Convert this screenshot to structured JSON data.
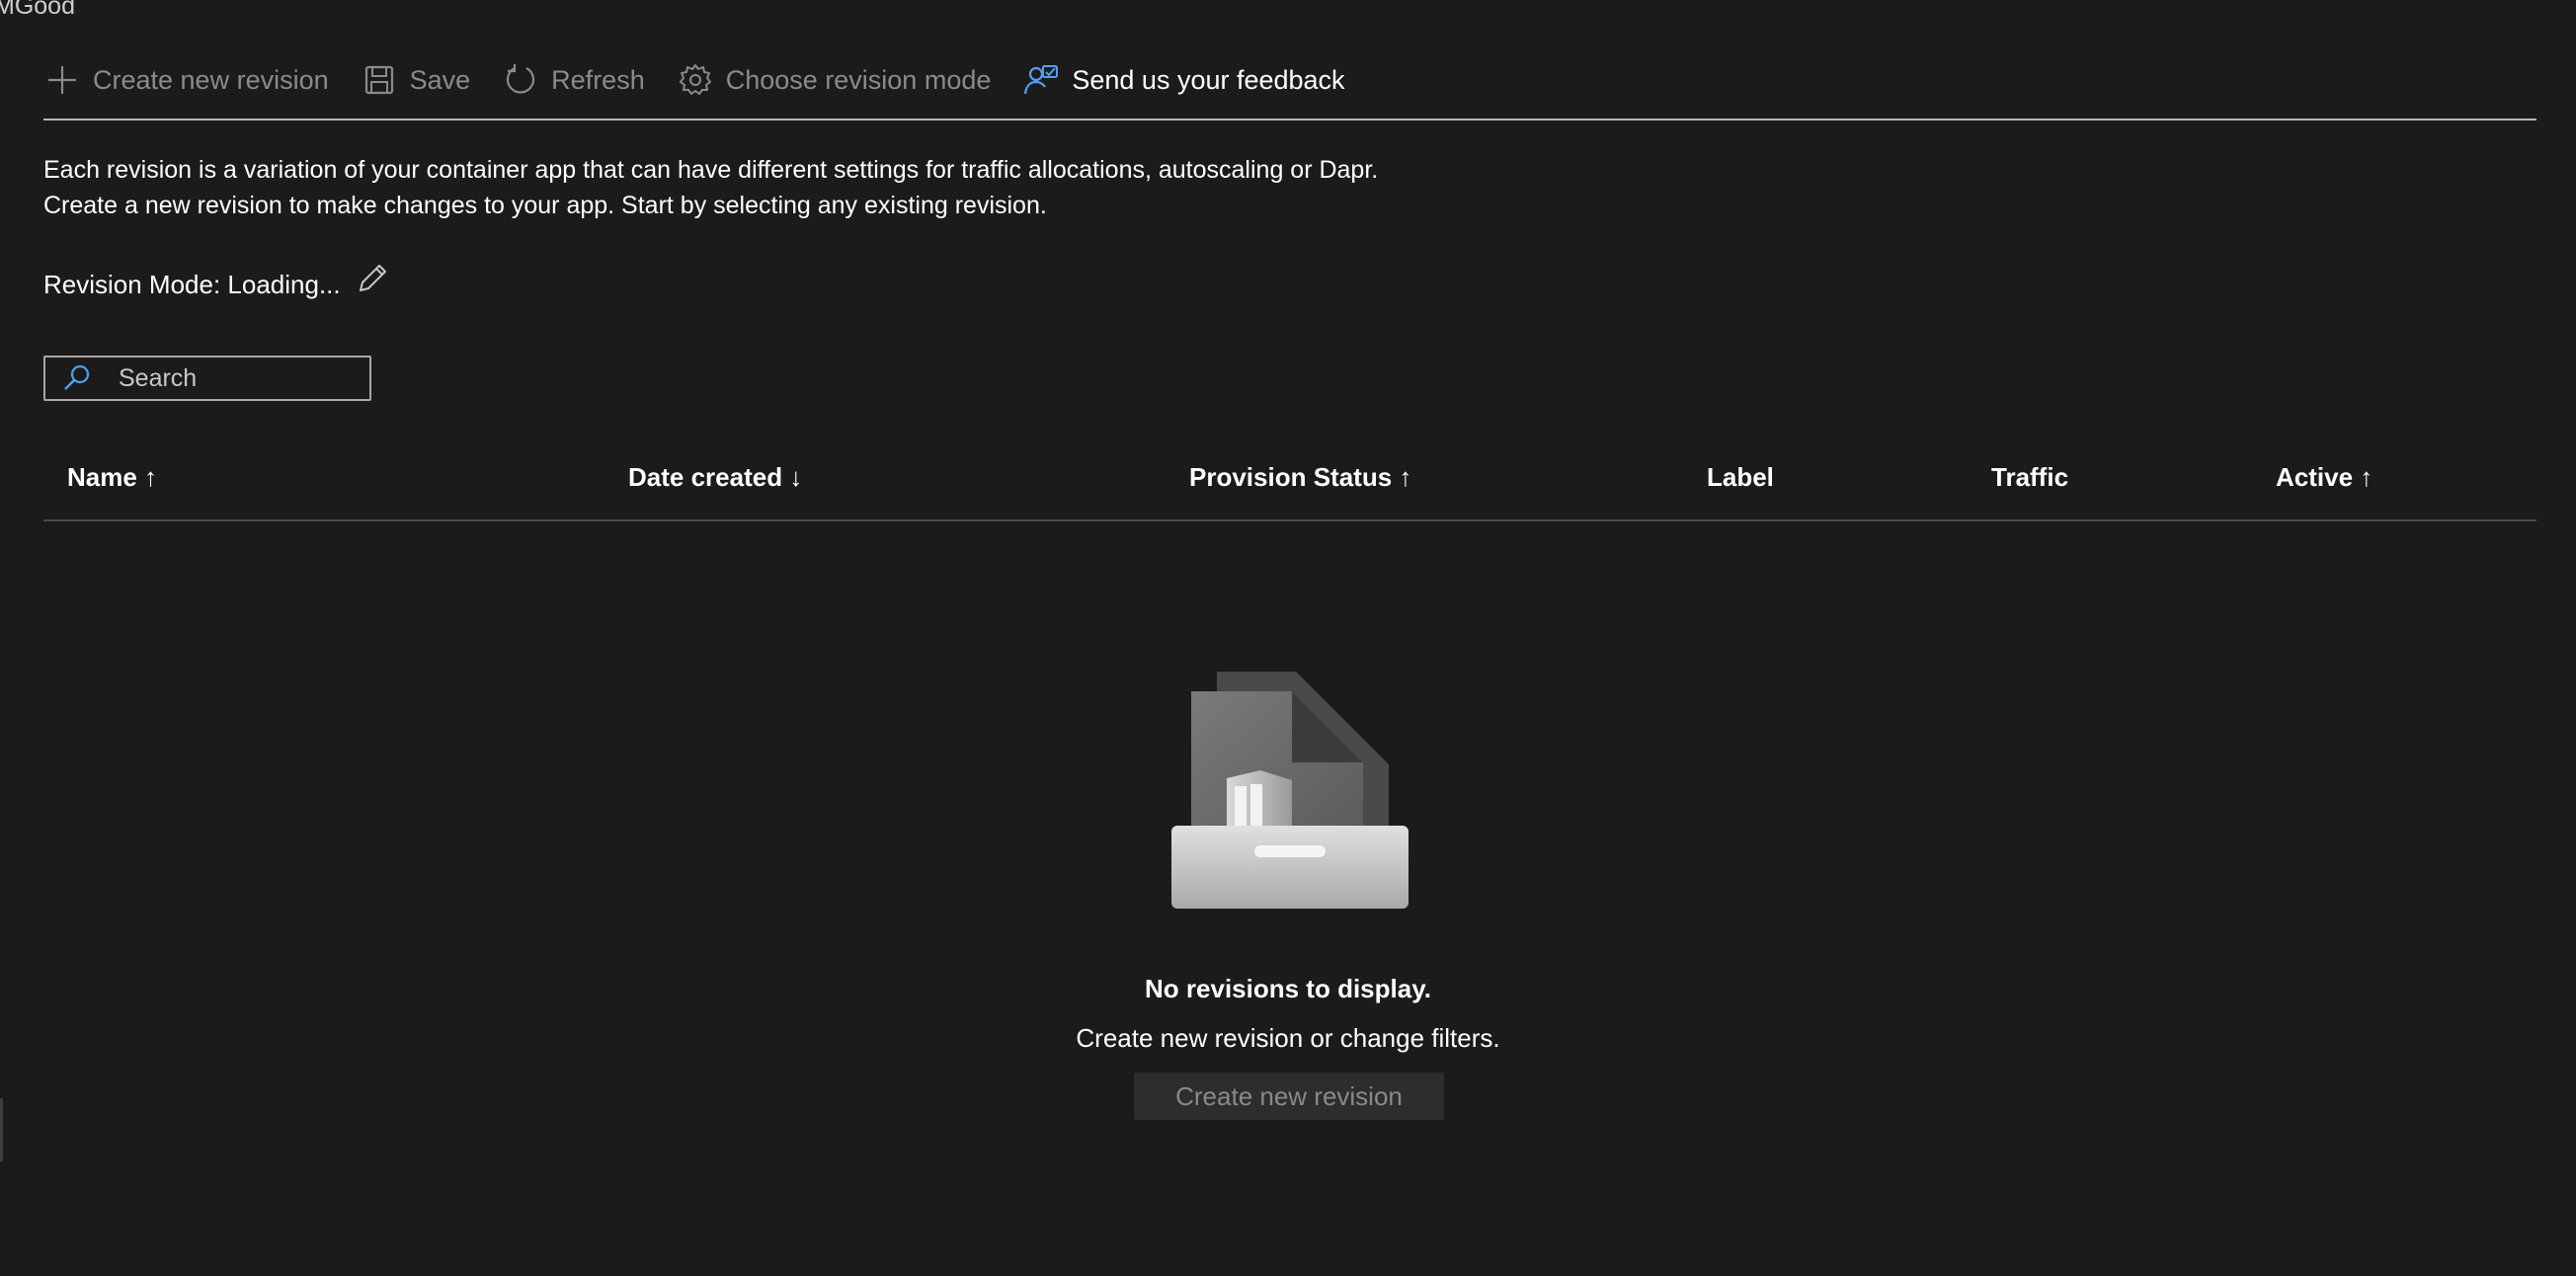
{
  "corner_text": "MGood",
  "toolbar": {
    "create_label": "Create new revision",
    "save_label": "Save",
    "refresh_label": "Refresh",
    "choose_mode_label": "Choose revision mode",
    "feedback_label": "Send us your feedback"
  },
  "description": {
    "line1": "Each revision is a variation of your container app that can have different settings for traffic allocations, autoscaling or Dapr.",
    "line2": "Create a new revision to make changes to your app. Start by selecting any existing revision."
  },
  "revision_mode": {
    "label": "Revision Mode: Loading..."
  },
  "search": {
    "placeholder": "Search",
    "value": ""
  },
  "table": {
    "columns": [
      {
        "label": "Name ↑"
      },
      {
        "label": "Date created ↓"
      },
      {
        "label": "Provision Status ↑"
      },
      {
        "label": "Label"
      },
      {
        "label": "Traffic"
      },
      {
        "label": "Active ↑"
      }
    ],
    "rows": []
  },
  "empty_state": {
    "title": "No revisions to display.",
    "subtitle": "Create new revision or change filters.",
    "button_label": "Create new revision"
  },
  "colors": {
    "background": "#1c1b1a",
    "accent": "#4ea1f3",
    "disabled_text": "#8b8b8b"
  }
}
